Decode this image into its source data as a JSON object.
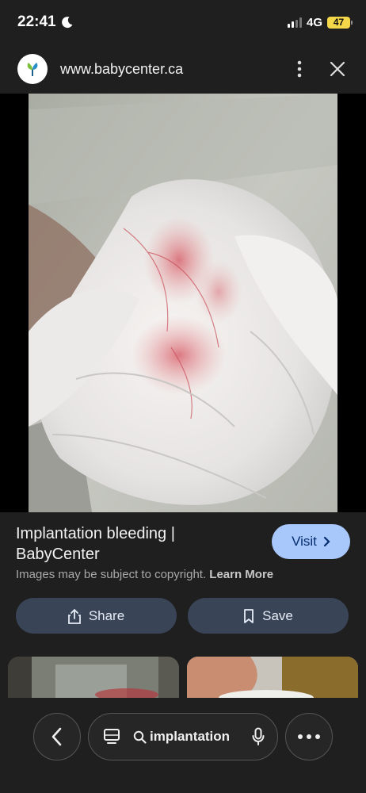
{
  "status_bar": {
    "time": "22:41",
    "network": "4G",
    "battery": "47"
  },
  "browser": {
    "url": "www.babycenter.ca"
  },
  "result": {
    "title_line1": "Implantation bleeding |",
    "title_line2": "BabyCenter",
    "visit_label": "Visit",
    "copyright_text": "Images may be subject to copyright.",
    "learn_more": "Learn More"
  },
  "actions": {
    "share_label": "Share",
    "save_label": "Save"
  },
  "bottom_bar": {
    "search_query": "implantation"
  },
  "colors": {
    "background": "#1f1f1f",
    "visit_button": "#a8c7fa",
    "action_button": "#394457",
    "battery": "#f5d84a"
  },
  "icons": [
    "moon-icon",
    "signal-icon",
    "site-logo-icon",
    "more-vert-icon",
    "close-icon",
    "chevron-right-icon",
    "share-icon",
    "bookmark-icon",
    "back-arrow-icon",
    "lens-icon",
    "search-icon",
    "mic-icon",
    "more-horiz-icon"
  ]
}
